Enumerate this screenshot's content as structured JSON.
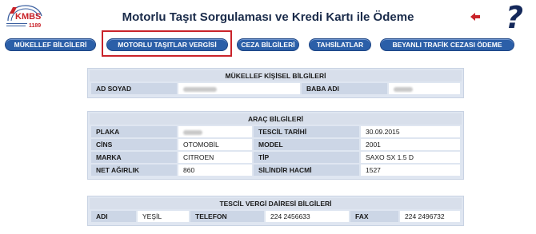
{
  "header": {
    "title": "Motorlu Taşıt Sorgulaması ve Kredi Kartı ile Ödeme",
    "logo_text": "KMBS",
    "logo_number": "1189",
    "back_icon": "back-arrow-icon",
    "help_glyph": "?"
  },
  "nav": {
    "items": [
      {
        "label": "MÜKELLEF BİLGİLERİ"
      },
      {
        "label": "MOTORLU TAŞITLAR VERGİSİ"
      },
      {
        "label": "CEZA BİLGİLERİ"
      },
      {
        "label": "TAHSİLATLAR"
      },
      {
        "label": "BEYANLI TRAFİK CEZASI ÖDEME"
      }
    ],
    "selected": "MOTORLU TAŞITLAR VERGİSİ"
  },
  "personal": {
    "title": "MÜKELLEF KİŞİSEL BİLGİLERİ",
    "name_label": "AD SOYAD",
    "father_label": "BABA ADI"
  },
  "vehicle": {
    "title": "ARAÇ BİLGİLERİ",
    "rows": [
      {
        "l1": "PLAKA",
        "v1": "",
        "l2": "TESCİL TARİHİ",
        "v2": "30.09.2015"
      },
      {
        "l1": "CİNS",
        "v1": "OTOMOBİL",
        "l2": "MODEL",
        "v2": "2001"
      },
      {
        "l1": "MARKA",
        "v1": "CITROEN",
        "l2": "TİP",
        "v2": "SAXO SX 1.5 D"
      },
      {
        "l1": "NET AĞIRLIK",
        "v1": "860",
        "l2": "SİLİNDİR HACMİ",
        "v2": "1527"
      }
    ]
  },
  "tax_office": {
    "title": "TESCİL VERGİ DAİRESİ BİLGİLERİ",
    "name_label": "ADI",
    "name_value": "YEŞİL",
    "phone_label": "TELEFON",
    "phone_value": "224 2456633",
    "fax_label": "FAX",
    "fax_value": "224 2496732"
  },
  "colors": {
    "nav_button": "#2b5fa8",
    "highlight": "#c9232a",
    "panel_label": "#ccd6e6"
  }
}
